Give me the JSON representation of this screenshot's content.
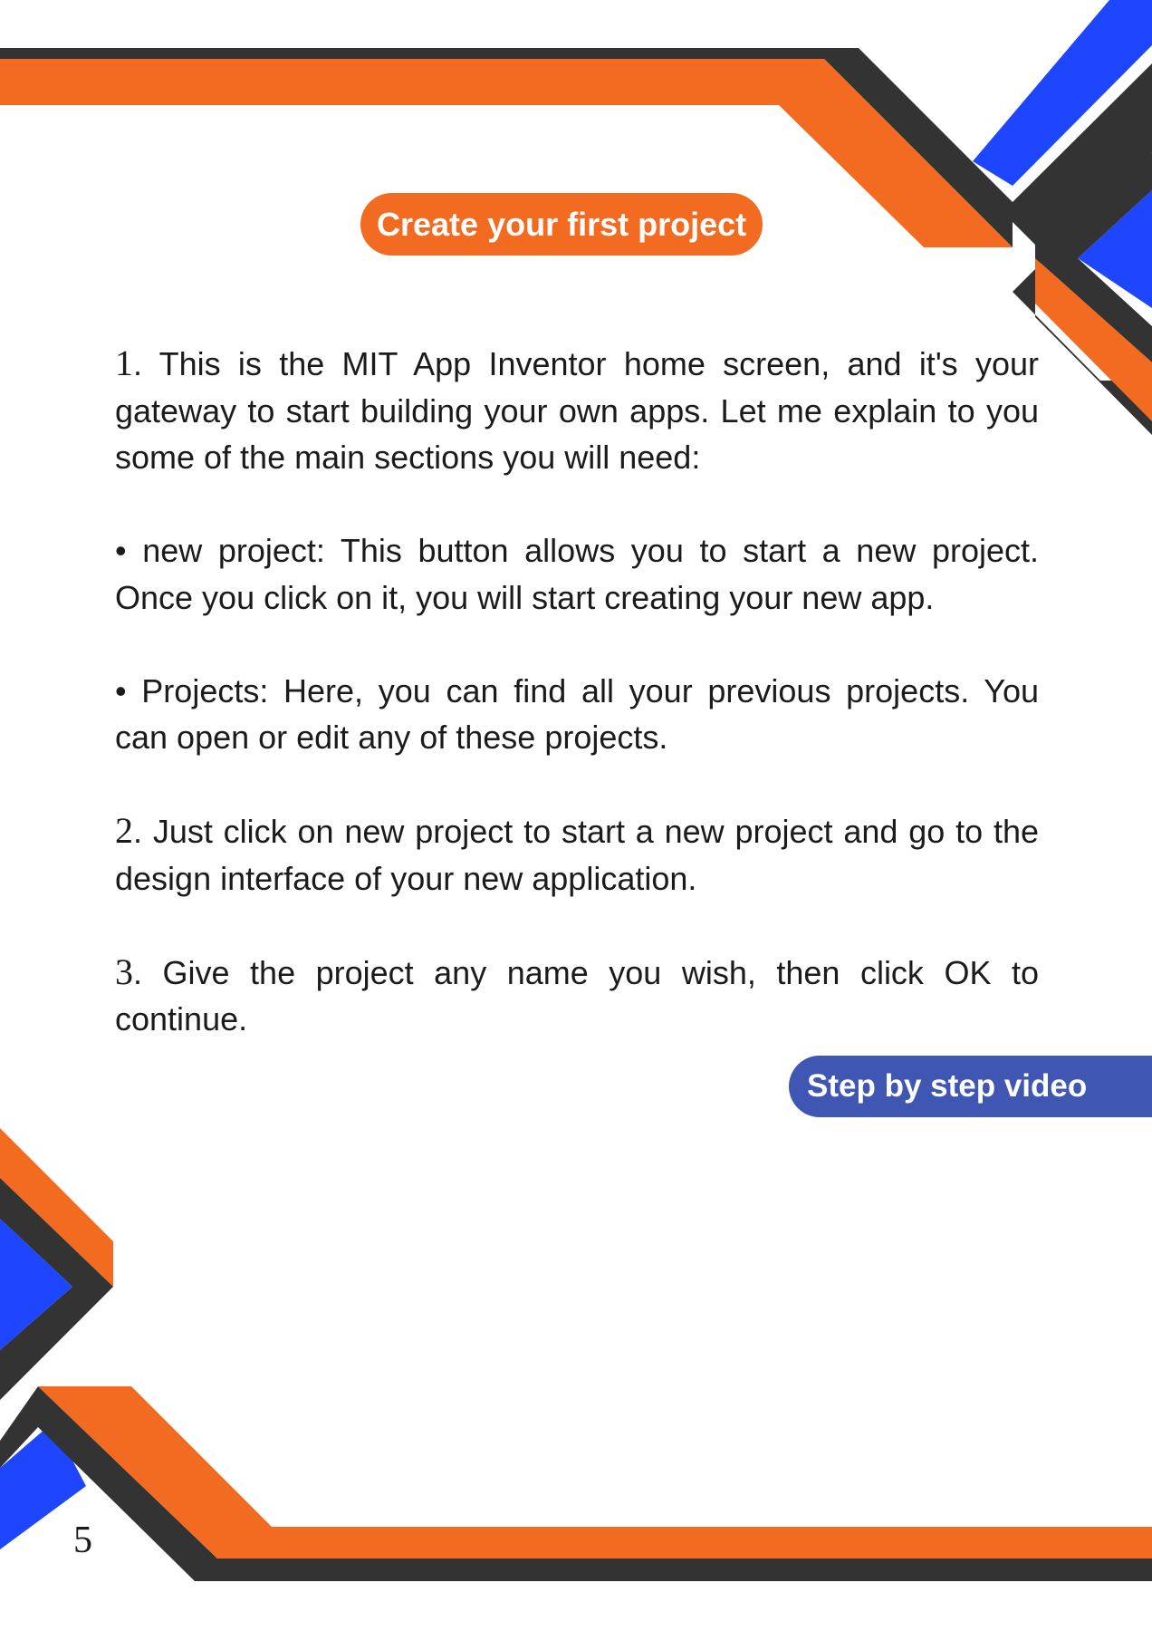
{
  "header": {
    "title": "Create your first project"
  },
  "steps": [
    {
      "number": "1",
      "text": ". This is the MIT App Inventor home screen, and it's your gateway to start building your own apps. Let me explain to you some of the main sections you will need:"
    },
    {
      "text": "• new project: This button allows you to start a new project. Once you click on it, you will start creating your new app."
    },
    {
      "text": "• Projects: Here, you can find all your previous projects. You can open or edit any of these projects."
    },
    {
      "number": "2",
      "text": ". Just click on new project to start a new project and go to the design interface of your new application."
    },
    {
      "number": "3",
      "text": ". Give the project any name you wish, then click OK to continue."
    }
  ],
  "video_button": {
    "label": "Step by step video"
  },
  "footer": {
    "page_number": "5"
  },
  "colors": {
    "orange": "#f26b21",
    "dark": "#333333",
    "blue": "#1e46ff",
    "video_button": "#3f56b3"
  }
}
